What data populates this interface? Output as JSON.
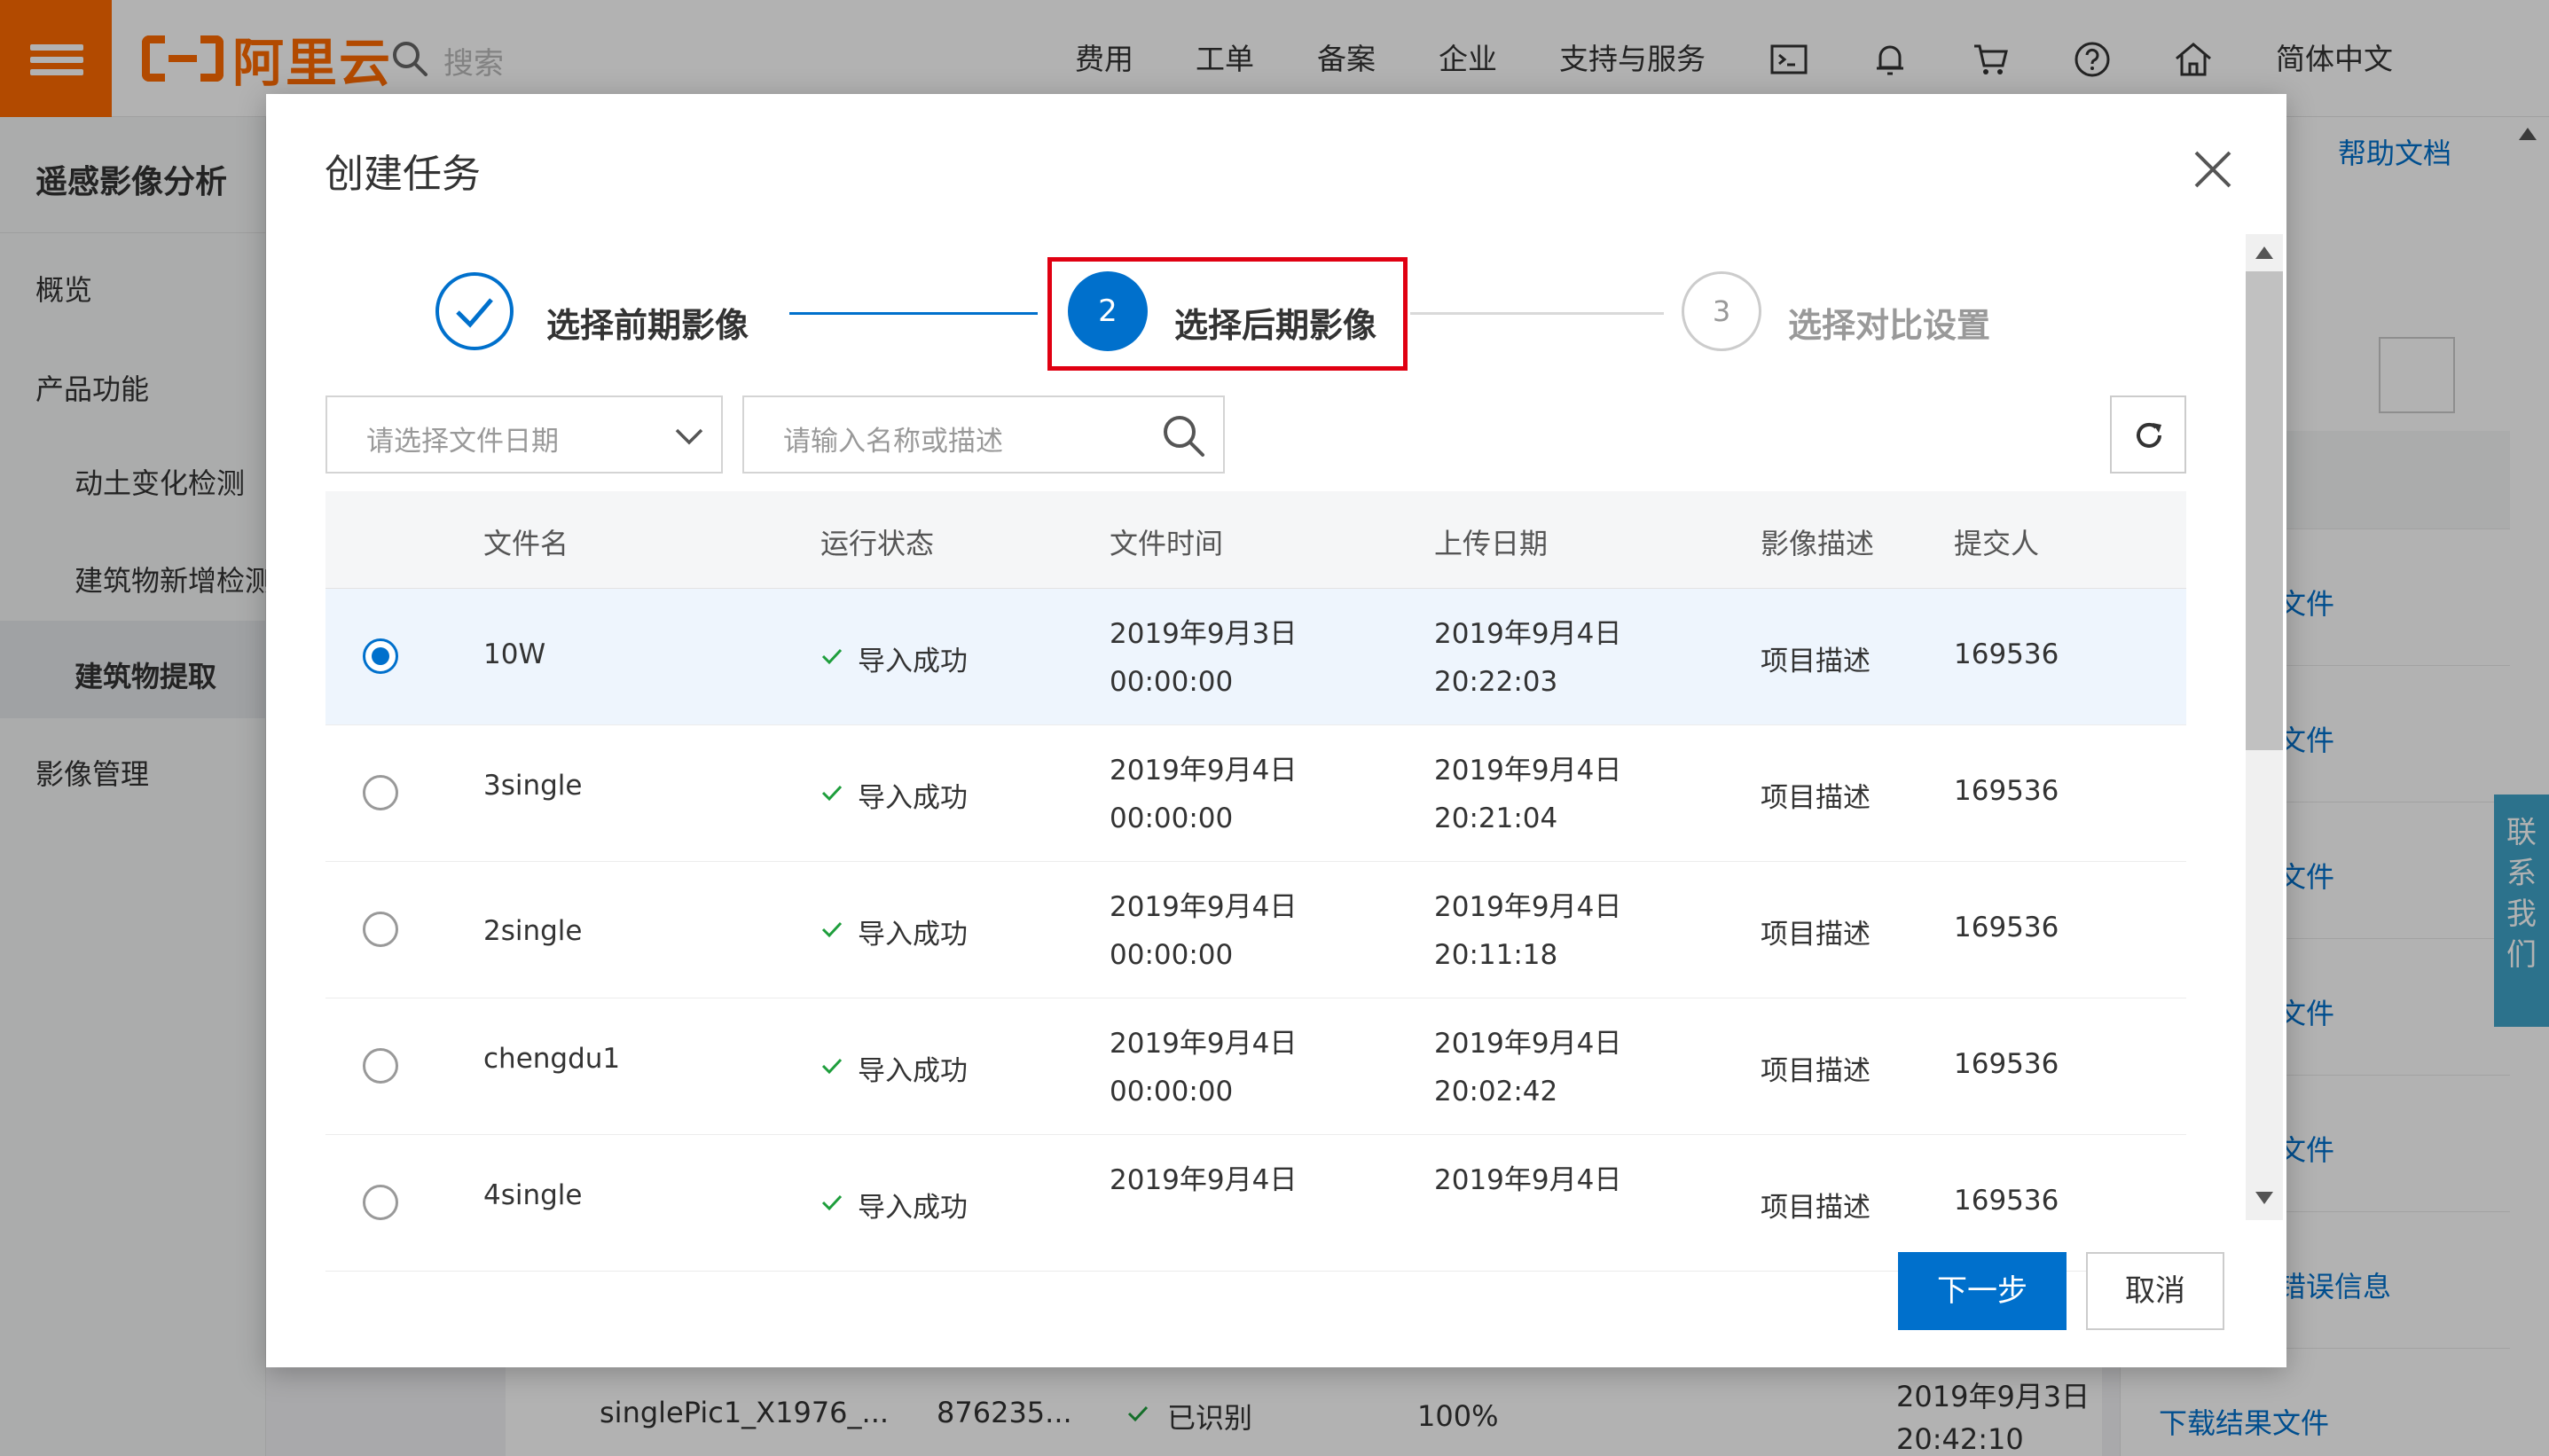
{
  "topbar": {
    "logo_text": "阿里云",
    "search_placeholder": "搜索",
    "nav": [
      "费用",
      "工单",
      "备案",
      "企业",
      "支持与服务"
    ],
    "language": "简体中文"
  },
  "sidebar": {
    "title": "遥感影像分析",
    "items": [
      "概览",
      "产品功能",
      "动土变化检测",
      "建筑物新增检测",
      "建筑物提取",
      "影像管理"
    ]
  },
  "background": {
    "help_link": "帮助文档",
    "row_links": [
      "文件",
      "文件",
      "文件",
      "文件",
      "文件",
      "错误信息"
    ],
    "download_link": "下载结果文件",
    "bottom_row": {
      "name": "singlePic1_X1976_...",
      "size": "876235...",
      "status": "已识别",
      "progress": "100%",
      "date": "2019年9月3日",
      "time": "20:42:10"
    },
    "contact_label": [
      "联",
      "系",
      "我",
      "们"
    ]
  },
  "dialog": {
    "title": "创建任务",
    "steps": [
      {
        "number": "",
        "label": "选择前期影像",
        "state": "done"
      },
      {
        "number": "2",
        "label": "选择后期影像",
        "state": "active"
      },
      {
        "number": "3",
        "label": "选择对比设置",
        "state": "pending"
      }
    ],
    "date_select_placeholder": "请选择文件日期",
    "search_placeholder": "请输入名称或描述",
    "table": {
      "columns": [
        "文件名",
        "运行状态",
        "文件时间",
        "上传日期",
        "影像描述",
        "提交人"
      ],
      "rows": [
        {
          "name": "10W",
          "status": "导入成功",
          "file_date": "2019年9月3日",
          "file_time": "00:00:00",
          "upload_date": "2019年9月4日",
          "upload_time": "20:22:03",
          "desc": "项目描述",
          "submitter": "169536",
          "selected": true
        },
        {
          "name": "3single",
          "status": "导入成功",
          "file_date": "2019年9月4日",
          "file_time": "00:00:00",
          "upload_date": "2019年9月4日",
          "upload_time": "20:21:04",
          "desc": "项目描述",
          "submitter": "169536",
          "selected": false
        },
        {
          "name": "2single",
          "status": "导入成功",
          "file_date": "2019年9月4日",
          "file_time": "00:00:00",
          "upload_date": "2019年9月4日",
          "upload_time": "20:11:18",
          "desc": "项目描述",
          "submitter": "169536",
          "selected": false
        },
        {
          "name": "chengdu1",
          "status": "导入成功",
          "file_date": "2019年9月4日",
          "file_time": "00:00:00",
          "upload_date": "2019年9月4日",
          "upload_time": "20:02:42",
          "desc": "项目描述",
          "submitter": "169536",
          "selected": false
        },
        {
          "name": "4single",
          "status": "导入成功",
          "file_date": "2019年9月4日",
          "file_time": "",
          "upload_date": "2019年9月4日",
          "upload_time": "",
          "desc": "项目描述",
          "submitter": "169536",
          "selected": false
        }
      ]
    },
    "next_label": "下一步",
    "cancel_label": "取消"
  },
  "colors": {
    "brand_orange": "#ff6a00",
    "primary_blue": "#0070cc",
    "highlight_red": "#e00012",
    "success_green": "#1e9e3c"
  }
}
